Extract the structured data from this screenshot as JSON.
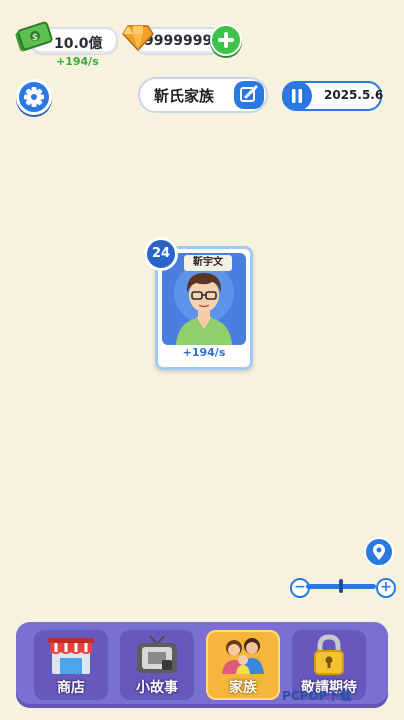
{
  "currency": {
    "money_value": "10.0億",
    "money_rate": "+194/s",
    "gems_value": "99999999"
  },
  "header": {
    "family_name": "靳氏家族",
    "date": "2025.5.6"
  },
  "character": {
    "level": "24",
    "name": "靳宇文",
    "rate": "+194/s"
  },
  "nav": {
    "items": [
      {
        "label": "商店"
      },
      {
        "label": "小故事"
      },
      {
        "label": "家族"
      },
      {
        "label": "敬請期待"
      }
    ],
    "active_index": 2
  },
  "zoom": {
    "level": 0.5
  },
  "watermark": "PCPOP下载",
  "colors": {
    "background": "#f7f2de",
    "accent": "#2a78e2",
    "nav": "#7b6fd1",
    "active_tab": "#f4b63b"
  }
}
